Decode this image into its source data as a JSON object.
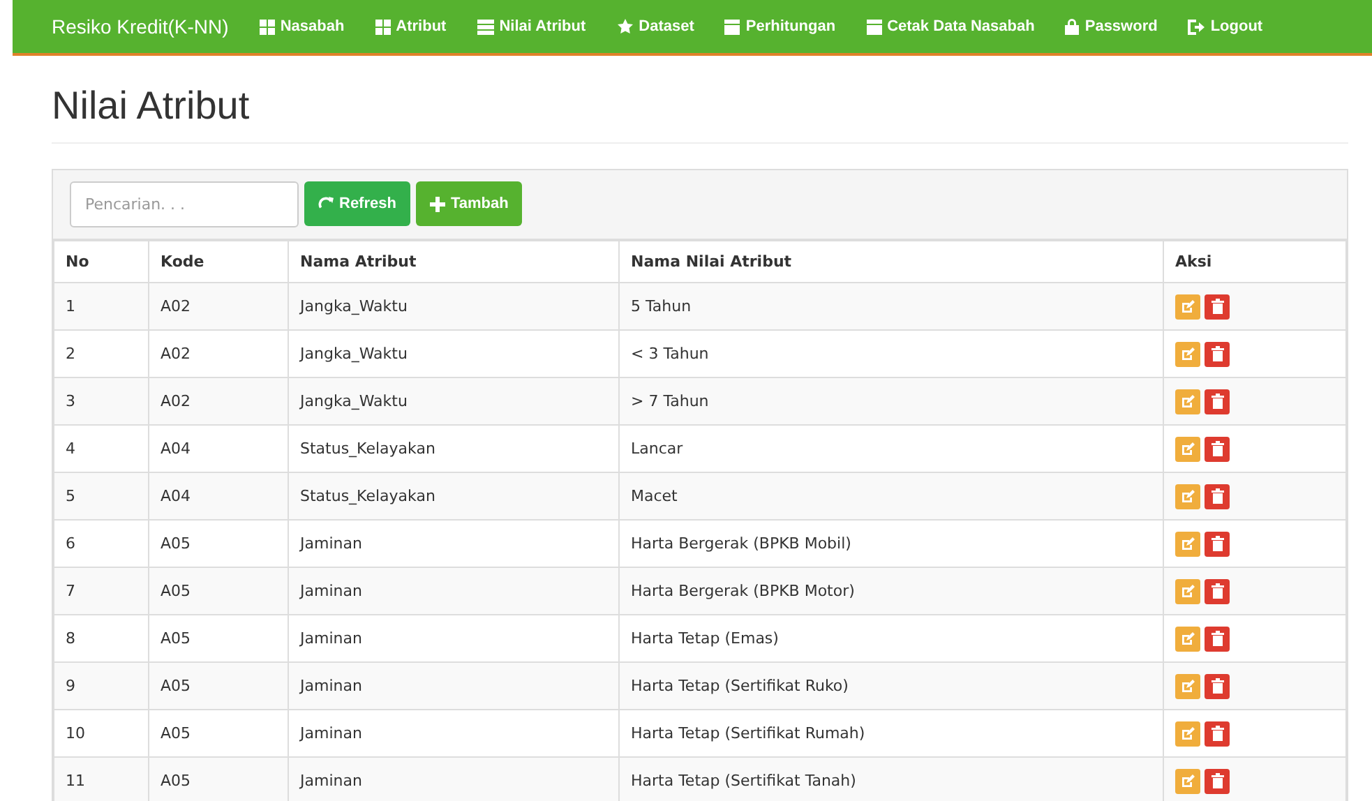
{
  "navbar": {
    "brand": "Resiko Kredit(K-NN)",
    "items": [
      {
        "label": "Nasabah"
      },
      {
        "label": "Atribut"
      },
      {
        "label": "Nilai Atribut"
      },
      {
        "label": "Dataset"
      },
      {
        "label": "Perhitungan"
      },
      {
        "label": "Cetak Data Nasabah"
      },
      {
        "label": "Password"
      },
      {
        "label": "Logout"
      }
    ]
  },
  "page_title": "Nilai Atribut",
  "toolbar": {
    "search": {
      "placeholder": "Pencarian. . ."
    },
    "buttons": [
      "Refresh",
      "Tambah"
    ]
  },
  "table": {
    "columns": [
      "No",
      "Kode",
      "Nama Atribut",
      "Nama Nilai Atribut",
      "Aksi"
    ],
    "rows": [
      [
        "1",
        "A02",
        "Jangka_Waktu",
        "5 Tahun"
      ],
      [
        "2",
        "A02",
        "Jangka_Waktu",
        "< 3 Tahun"
      ],
      [
        "3",
        "A02",
        "Jangka_Waktu",
        "> 7 Tahun"
      ],
      [
        "4",
        "A04",
        "Status_Kelayakan",
        "Lancar"
      ],
      [
        "5",
        "A04",
        "Status_Kelayakan",
        "Macet"
      ],
      [
        "6",
        "A05",
        "Jaminan",
        "Harta Bergerak (BPKB Mobil)"
      ],
      [
        "7",
        "A05",
        "Jaminan",
        "Harta Bergerak (BPKB Motor)"
      ],
      [
        "8",
        "A05",
        "Jaminan",
        "Harta Tetap (Emas)"
      ],
      [
        "9",
        "A05",
        "Jaminan",
        "Harta Tetap (Sertifikat Ruko)"
      ],
      [
        "10",
        "A05",
        "Jaminan",
        "Harta Tetap (Sertifikat Rumah)"
      ],
      [
        "11",
        "A05",
        "Jaminan",
        "Harta Tetap (Sertifikat Tanah)"
      ]
    ]
  }
}
